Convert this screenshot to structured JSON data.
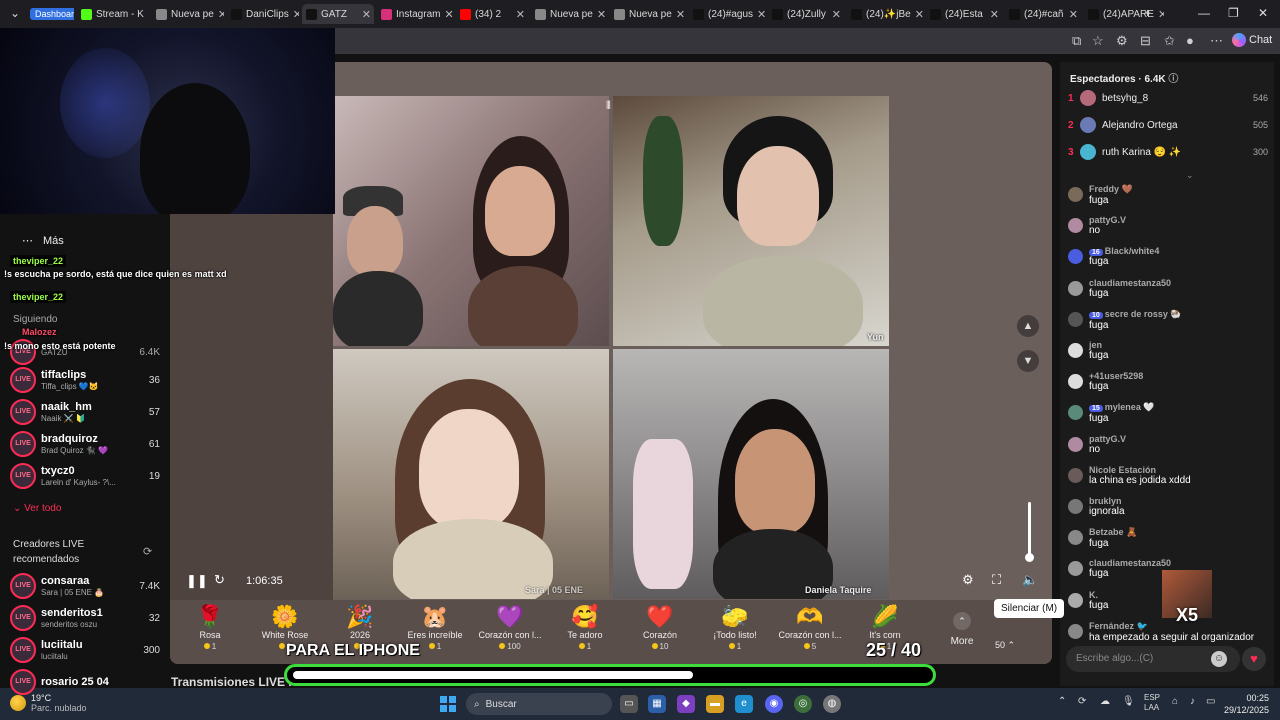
{
  "browser": {
    "tabs": [
      {
        "label": "Dashboard",
        "favicon": "dashboard",
        "active": false
      },
      {
        "label": "Stream - K",
        "favicon": "kick-icon",
        "active": false
      },
      {
        "label": "Nueva pe",
        "favicon": "tab-icon",
        "active": false
      },
      {
        "label": "DaniClips",
        "favicon": "tiktok-icon",
        "active": false
      },
      {
        "label": "GATZ",
        "favicon": "tiktok-icon",
        "active": true
      },
      {
        "label": "Instagram",
        "favicon": "instagram-icon",
        "active": false
      },
      {
        "label": "(34) 2",
        "favicon": "youtube-icon",
        "active": false
      },
      {
        "label": "Nueva pe",
        "favicon": "tab-icon",
        "active": false
      },
      {
        "label": "Nueva pe",
        "favicon": "tab-icon",
        "active": false
      },
      {
        "label": "(24)#agus",
        "favicon": "tiktok-icon",
        "active": false
      },
      {
        "label": "(24)Zully",
        "favicon": "tiktok-icon",
        "active": false
      },
      {
        "label": "(24)✨jBe",
        "favicon": "tiktok-icon",
        "active": false
      },
      {
        "label": "(24)Esta",
        "favicon": "tiktok-icon",
        "active": false
      },
      {
        "label": "(24)#cañ",
        "favicon": "tiktok-icon",
        "active": false
      },
      {
        "label": "(24)APARE",
        "favicon": "tiktok-icon",
        "active": false
      }
    ],
    "new_tab_label": "+",
    "chat_button": "Chat"
  },
  "sidebar": {
    "more_label": "Más",
    "following_label": "Siguiendo",
    "see_all": "Ver todo",
    "recommended_title": "Creadores LIVE recomendados",
    "top_count": "6.4K",
    "top_sub": "GATZU",
    "following": [
      {
        "name": "tiffaclips",
        "sub": "Tiffa_clips 💙🐱",
        "count": "36"
      },
      {
        "name": "naaik_hm",
        "sub": "Naaik ⚔️ 🔰",
        "count": "57"
      },
      {
        "name": "bradquiroz",
        "sub": "Brad Quiroz 🐈‍⬛ 💜",
        "count": "61"
      },
      {
        "name": "txycz0",
        "sub": "Lareln d' Kaylus- ?\\...",
        "count": "19"
      }
    ],
    "recommended": [
      {
        "name": "consaraa",
        "sub": "Sara | 05 ENE 🎂",
        "count": "7.4K"
      },
      {
        "name": "senderitos1",
        "sub": "senderitos oszu",
        "count": "32"
      },
      {
        "name": "luciitalu",
        "sub": "luciitalu",
        "count": "300"
      },
      {
        "name": "rosario 25 04",
        "sub": "",
        "count": ""
      }
    ]
  },
  "overlay_chat": {
    "user1": "theviper_22",
    "msg1": "!s escucha pe sordo, está que dice quien es matt xd",
    "user2": "theviper_22",
    "msg2": "!s mono esto está potente",
    "badge_text": "Malozez"
  },
  "stream": {
    "timecode": "1:06:35",
    "tile_labels": [
      "Yun",
      "Sara | 05 ENE",
      "Daniela Taquire"
    ],
    "mute_tooltip": "Silenciar (M)",
    "volume_level": 0.1,
    "gifts": [
      {
        "name": "Rosa",
        "price": "1",
        "icon": "🌹"
      },
      {
        "name": "White Rose",
        "price": "1",
        "icon": "🌼"
      },
      {
        "name": "2026",
        "price": "1",
        "icon": "🎉"
      },
      {
        "name": "Eres increíble",
        "price": "1",
        "icon": "🐹"
      },
      {
        "name": "Corazón con l...",
        "price": "100",
        "icon": "💜"
      },
      {
        "name": "Te adoro",
        "price": "1",
        "icon": "🥰"
      },
      {
        "name": "Corazón",
        "price": "10",
        "icon": "❤️"
      },
      {
        "name": "¡Todo listo!",
        "price": "1",
        "icon": "🧽"
      },
      {
        "name": "Corazón con l...",
        "price": "5",
        "icon": "🫶"
      },
      {
        "name": "It's corn",
        "price": "1",
        "icon": "🌽"
      }
    ],
    "more_label": "More",
    "coins_label": "50",
    "recommended_title": "Transmisiones LIVE recomendadas"
  },
  "overlay": {
    "para_iphone": "PARA EL IPHONE",
    "progress_text": "25 / 40",
    "progress_value": 0.625,
    "accent": "#3ddc3d"
  },
  "viewers": {
    "title": "Espectadores · 6.4K",
    "top": [
      {
        "rank": "1",
        "name": "betsyhg_8",
        "score": "546",
        "color": "#b56a7a"
      },
      {
        "rank": "2",
        "name": "Alejandro Ortega",
        "score": "505",
        "color": "#6a7ab5"
      },
      {
        "rank": "3",
        "name": "ruth Karina 😌 ✨",
        "score": "300",
        "color": "#4ab5d0"
      }
    ]
  },
  "chat": {
    "messages": [
      {
        "user": "Freddy 🤎",
        "text": "fuga",
        "badge": ""
      },
      {
        "user": "pattyG.V",
        "text": "no",
        "badge": ""
      },
      {
        "user": "Black/white4",
        "text": "fuga",
        "badge": "16"
      },
      {
        "user": "claudiamestanza50",
        "text": "fuga",
        "badge": ""
      },
      {
        "user": "secre de rossy 🐏",
        "text": "fuga",
        "badge": "10"
      },
      {
        "user": "jen",
        "text": "fuga",
        "badge": ""
      },
      {
        "user": "+41user5298",
        "text": "fuga",
        "badge": ""
      },
      {
        "user": "mylenea 🤍",
        "text": "fuga",
        "badge": "15"
      },
      {
        "user": "pattyG.V",
        "text": "no",
        "badge": ""
      },
      {
        "user": "Nicole Estación",
        "text": "la china es jodida xddd",
        "badge": ""
      },
      {
        "user": "bruklyn",
        "text": "ignorala",
        "badge": ""
      },
      {
        "user": "Betzabe 🧸",
        "text": "fuga",
        "badge": ""
      },
      {
        "user": "claudiamestanza50",
        "text": "fuga",
        "badge": ""
      },
      {
        "user": "K.",
        "text": "fuga",
        "badge": ""
      },
      {
        "user": "Fernández 🐦",
        "text": "ha empezado a seguir al organizador",
        "badge": ""
      }
    ],
    "input_placeholder": "Escribe algo...(C)",
    "x5_label": "X5"
  },
  "taskbar": {
    "weather_temp": "19°C",
    "weather_desc": "Parc. nublado",
    "search_label": "Buscar",
    "lang": "ESP",
    "lang_sub": "LAA",
    "time": "00:25",
    "date": "29/12/2025"
  }
}
